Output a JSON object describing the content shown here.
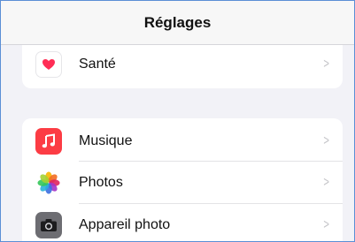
{
  "navbar": {
    "title": "Réglages"
  },
  "group1": {
    "items": [
      {
        "label": "Santé",
        "icon": "heart-icon",
        "chevron": ">"
      }
    ]
  },
  "group2": {
    "items": [
      {
        "label": "Musique",
        "icon": "music-note-icon",
        "chevron": ">"
      },
      {
        "label": "Photos",
        "icon": "photos-flower-icon",
        "chevron": ">"
      },
      {
        "label": "Appareil photo",
        "icon": "camera-icon",
        "chevron": ">"
      }
    ]
  },
  "colors": {
    "background": "#f2f2f7",
    "health_heart": "#ff2d55",
    "music_icon": "#fc3c44",
    "camera_icon": "#6d6d72"
  }
}
